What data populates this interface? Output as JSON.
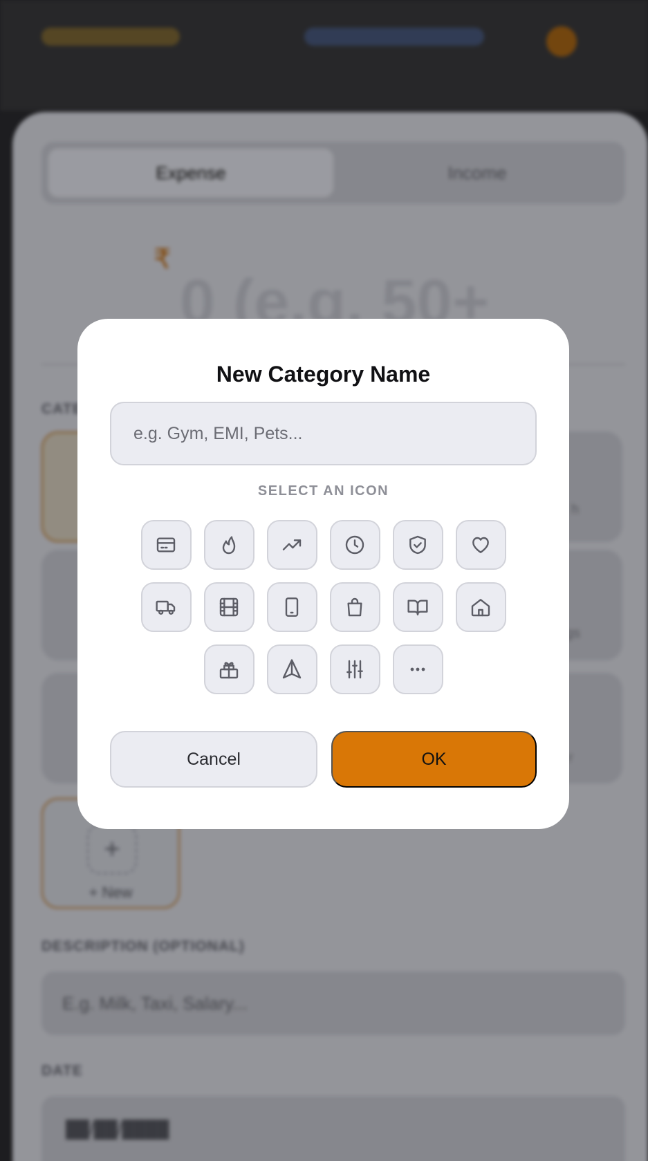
{
  "background": {
    "type_tabs": {
      "expense": "Expense",
      "income": "Income"
    },
    "currency_symbol": "₹",
    "amount_placeholder": "0 (e.g. 50+",
    "category_label": "CATE",
    "new_category_button": {
      "plus": "+",
      "label": "+ New"
    },
    "right_card_labels": [
      "h",
      "gs",
      "r"
    ],
    "description": {
      "label": "DESCRIPTION (OPTIONAL)",
      "placeholder": "E.g. Milk, Taxi, Salary..."
    },
    "date": {
      "label": "DATE",
      "value": "██/██/████"
    }
  },
  "modal": {
    "title": "New Category Name",
    "name_input": {
      "value": "",
      "placeholder": "e.g. Gym, EMI, Pets..."
    },
    "icon_section_label": "SELECT AN ICON",
    "icons": [
      [
        "credit-card-icon",
        "flame-icon",
        "trending-up-icon",
        "clock-icon",
        "shield-check-icon",
        "heart-icon"
      ],
      [
        "truck-icon",
        "film-icon",
        "smartphone-icon",
        "shopping-bag-icon",
        "book-open-icon",
        "home-icon"
      ],
      [
        "gift-icon",
        "navigation-icon",
        "sliders-icon",
        "more-horizontal-icon"
      ]
    ],
    "buttons": {
      "cancel": "Cancel",
      "ok": "OK"
    }
  },
  "colors": {
    "accent": "#d97706",
    "field_bg": "#ebecf2",
    "field_border": "#d2d3da"
  }
}
